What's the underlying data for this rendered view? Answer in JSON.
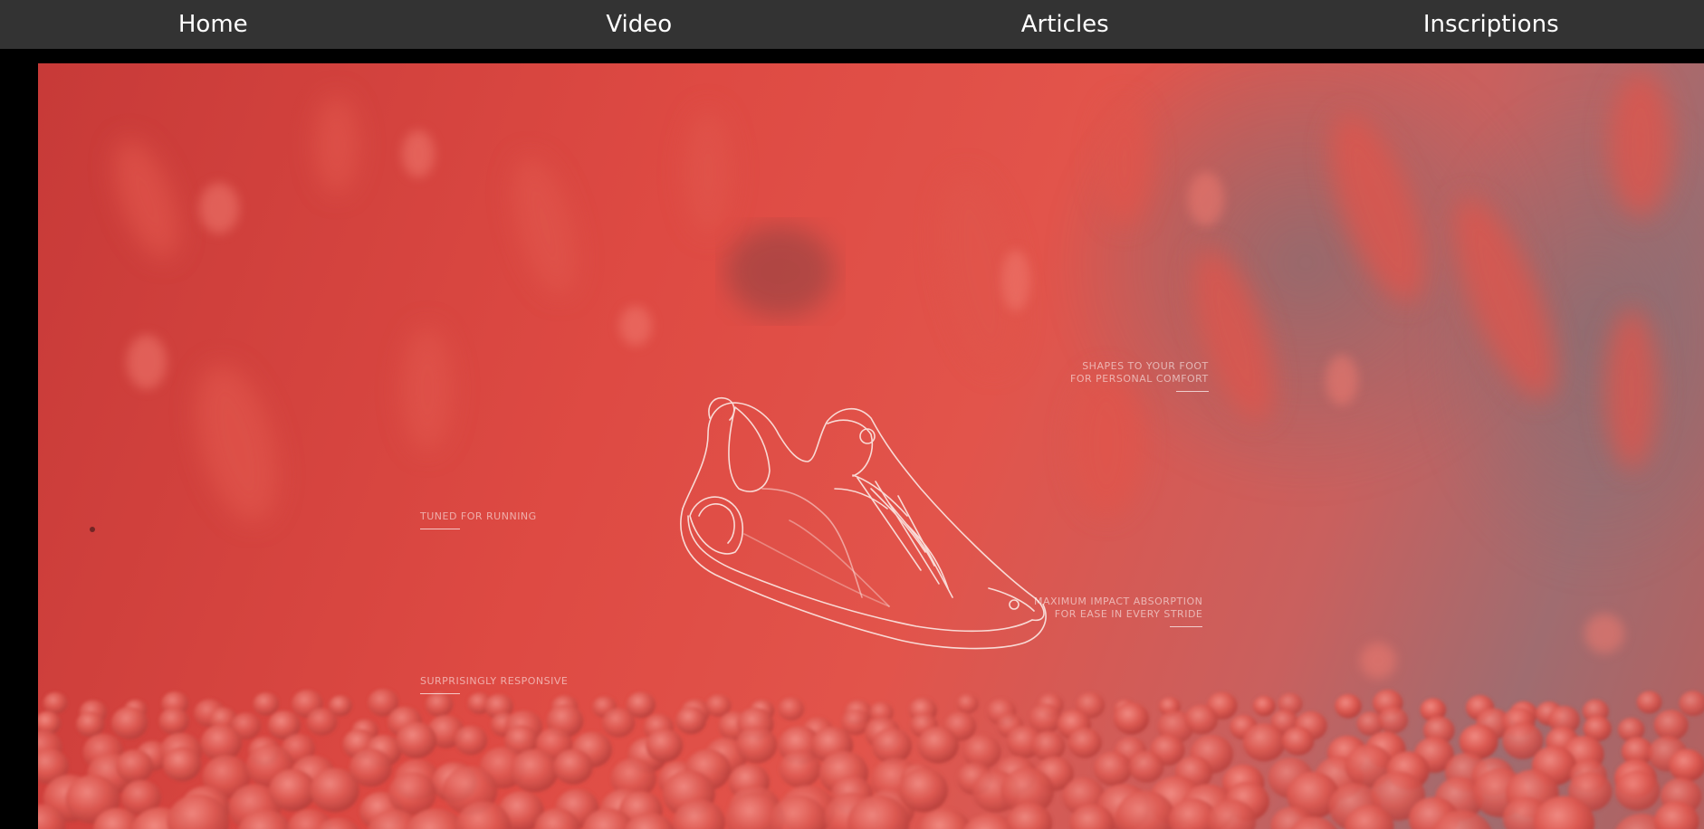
{
  "nav": {
    "items": [
      {
        "label": "Home"
      },
      {
        "label": "Video"
      },
      {
        "label": "Articles"
      },
      {
        "label": "Inscriptions"
      }
    ]
  },
  "video": {
    "callouts": {
      "foot": {
        "line1": "SHAPES TO YOUR FOOT",
        "line2": "FOR PERSONAL COMFORT"
      },
      "running": {
        "line1": "TUNED FOR RUNNING"
      },
      "impact": {
        "line1": "MAXIMUM IMPACT ABSORPTION",
        "line2": "FOR EASE IN EVERY STRIDE"
      },
      "responsive": {
        "line1": "SURPRISINGLY RESPONSIVE"
      }
    },
    "icon": "sneaker-wireframe-icon"
  },
  "colors": {
    "navbar": "#333333",
    "nav_text": "#ffffff",
    "video_red": "#de4a43",
    "page_bg": "#000000"
  }
}
